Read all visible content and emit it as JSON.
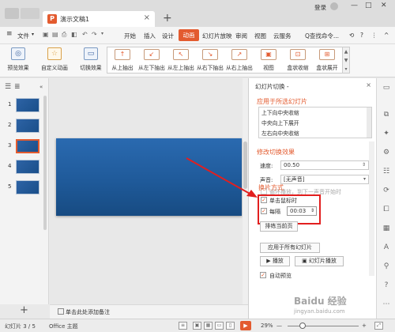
{
  "titlebar": {
    "doc_title": "演示文稿1",
    "close_glyph": "×",
    "new_tab_glyph": "+",
    "login_label": "登录",
    "minimize_glyph": "—",
    "maximize_glyph": "□",
    "close_window_glyph": "✕"
  },
  "menubar": {
    "menu_glyph": "≡",
    "file_label": "文件",
    "items": [
      "开始",
      "插入",
      "设计",
      "动画",
      "幻灯片放映",
      "审阅",
      "视图",
      "云服务"
    ],
    "active": "动画",
    "search_label": "Q查找命令...",
    "help_glyph": "?",
    "more_glyph": "⋮",
    "collapse_glyph": "^"
  },
  "ribbon": {
    "preview_label": "预览效果",
    "custom_anim_label": "自定义动画",
    "switch_effect_label": "切换效果",
    "effects": [
      "从上抽出",
      "从左下抽出",
      "从左上抽出",
      "从右下抽出",
      "从右上抽出",
      "视图",
      "盒状收缩",
      "盒状展开"
    ]
  },
  "slides": {
    "numbers": [
      "1",
      "2",
      "3",
      "4",
      "5"
    ],
    "selected": "3",
    "add_glyph": "+"
  },
  "notes": {
    "placeholder": "单击此处添加备注"
  },
  "taskpane": {
    "title": "幻灯片切换 -",
    "close_glyph": "×",
    "apply_section": "应用于所选幻灯片",
    "list_items": [
      "上下向中央收缩",
      "中央向上下展开",
      "左右向中央收缩"
    ],
    "modify_section": "修改切换效果",
    "speed_label": "速度:",
    "speed_value": "00.50",
    "sound_label": "声音:",
    "sound_value": "[无声音]",
    "loop_label": "循环播放，到下一声音开始时",
    "switch_mode_section": "换片方式",
    "on_click_label": "单击鼠标时",
    "interval_label": "每隔",
    "interval_value": "00:03",
    "rehearse_label": "排练当前页",
    "apply_all_label": "应用于所有幻灯片",
    "play_label": "播放",
    "slideshow_label": "幻灯片播放",
    "autopreview_label": "自动预览"
  },
  "statusbar": {
    "slide_info": "幻灯片 3 / 5",
    "theme": "Office 主题",
    "zoom": "29%",
    "play_glyph": "▶"
  },
  "watermark": {
    "text": "Baidu 经验",
    "sub": "jingyan.baidu.com"
  },
  "colors": {
    "accent": "#e35b2f",
    "annotation_red": "#e21f1f",
    "slide_blue": "#1f5a9a"
  }
}
